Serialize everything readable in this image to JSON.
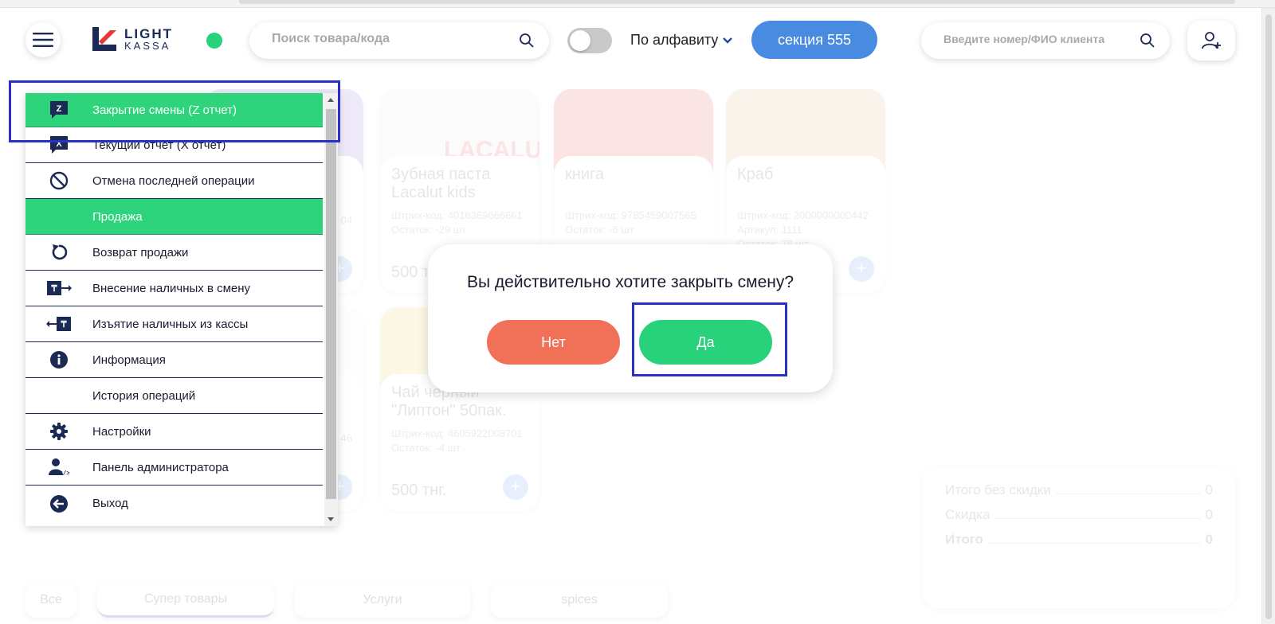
{
  "header": {
    "logo_line1": "LIGHT",
    "logo_line2": "KASSA",
    "search_placeholder": "Поиск товара/кода",
    "sort_label": "По алфавиту",
    "section_button": "секция 555",
    "client_search_placeholder": "Введите номер/ФИО клиента",
    "status_color": "#27d27a",
    "accent_color": "#4a8be2"
  },
  "menu": {
    "items": [
      {
        "label": "Закрытие смены (Z отчет)",
        "icon": "z-report-icon",
        "active": true
      },
      {
        "label": "Текущий отчет (X отчет)",
        "icon": "x-report-icon",
        "active": false
      },
      {
        "label": "Отмена последней операции",
        "icon": "cancel-icon",
        "active": false
      },
      {
        "label": "Продажа",
        "icon": "",
        "active": true
      },
      {
        "label": "Возврат продажи",
        "icon": "return-icon",
        "active": false
      },
      {
        "label": "Внесение наличных в смену",
        "icon": "cash-in-icon",
        "active": false
      },
      {
        "label": "Изъятие наличных из кассы",
        "icon": "cash-out-icon",
        "active": false
      },
      {
        "label": "Информация",
        "icon": "info-icon",
        "active": false
      },
      {
        "label": "История операций",
        "icon": "",
        "active": false
      },
      {
        "label": "Настройки",
        "icon": "gear-icon",
        "active": false
      },
      {
        "label": "Панель администратора",
        "icon": "admin-icon",
        "active": false
      },
      {
        "label": "Выход",
        "icon": "exit-icon",
        "active": false
      }
    ],
    "active_color": "#2ed47c"
  },
  "products": [
    {
      "name": "Зубная паста Lacalut kids",
      "barcode": "Штрих-код: 4016369666661",
      "stock": "Остаток: -29 шт",
      "price": "500 т"
    },
    {
      "name": "книга",
      "barcode": "Штрих-код: 9785459007565",
      "stock": "Остаток: -6 шт",
      "price": ""
    },
    {
      "name": "Краб",
      "barcode": "Штрих-код: 2000000000442",
      "article": "Артикул: 1111",
      "stock": "Остаток: 78 шт",
      "price": ""
    },
    {
      "name": "Чай черный \"Липтон\" 50пак.",
      "barcode": "Штрих-код: 4605922008701",
      "stock": "Остаток: -4 шт",
      "price": "500 тнг."
    }
  ],
  "partial_cards": {
    "top_barcode_tail": "04",
    "bottom_barcode_tail": "46"
  },
  "categories": [
    "Все",
    "Супер товары",
    "Услуги",
    "spices"
  ],
  "totals": {
    "rows": [
      {
        "label": "Итого без скидки",
        "value": "0"
      },
      {
        "label": "Скидка",
        "value": "0"
      },
      {
        "label": "Итого",
        "value": "0"
      }
    ]
  },
  "dialog": {
    "question": "Вы действительно хотите закрыть смену?",
    "no_label": "Нет",
    "yes_label": "Да",
    "no_color": "#f07058",
    "yes_color": "#27d27a"
  }
}
